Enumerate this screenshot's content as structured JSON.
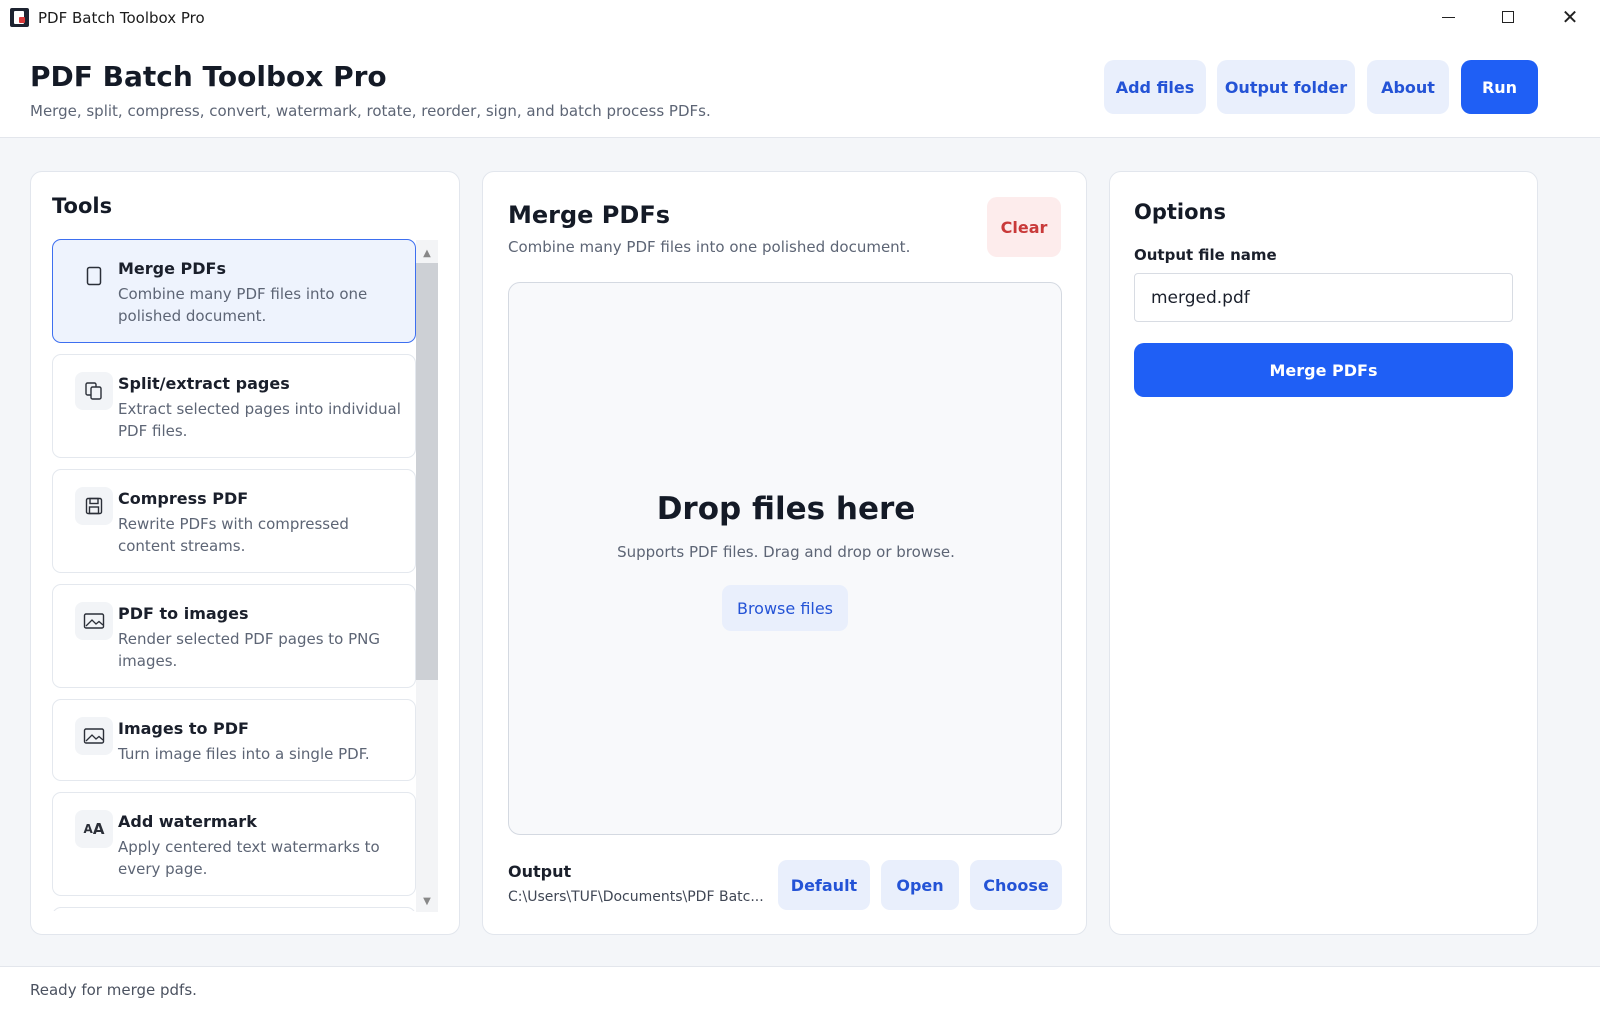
{
  "window": {
    "title": "PDF Batch Toolbox Pro"
  },
  "header": {
    "title": "PDF Batch Toolbox Pro",
    "subtitle": "Merge, split, compress, convert, watermark, rotate, reorder, sign, and batch process PDFs.",
    "buttons": {
      "add_files": "Add files",
      "output_folder": "Output folder",
      "about": "About",
      "run": "Run"
    }
  },
  "tools": {
    "heading": "Tools",
    "items": [
      {
        "title": "Merge PDFs",
        "desc": "Combine many PDF files into one polished document.",
        "icon": "document-icon",
        "active": true
      },
      {
        "title": "Split/extract pages",
        "desc": "Extract selected pages into individual PDF files.",
        "icon": "copy-pages-icon"
      },
      {
        "title": "Compress PDF",
        "desc": "Rewrite PDFs with compressed content streams.",
        "icon": "save-disk-icon"
      },
      {
        "title": "PDF to images",
        "desc": "Render selected PDF pages to PNG images.",
        "icon": "image-icon"
      },
      {
        "title": "Images to PDF",
        "desc": "Turn image files into a single PDF.",
        "icon": "image-icon"
      },
      {
        "title": "Add watermark",
        "desc": "Apply centered text watermarks to every page.",
        "icon": "text-size-icon"
      }
    ]
  },
  "main": {
    "title": "Merge PDFs",
    "subtitle": "Combine many PDF files into one polished document.",
    "clear_label": "Clear",
    "dropzone": {
      "title": "Drop files here",
      "subtitle": "Supports PDF files. Drag and drop or browse.",
      "browse_label": "Browse files"
    },
    "output": {
      "label": "Output",
      "path": "C:\\Users\\TUF\\Documents\\PDF Batc...",
      "default_label": "Default",
      "open_label": "Open",
      "choose_label": "Choose"
    }
  },
  "options": {
    "heading": "Options",
    "filename_label": "Output file name",
    "filename_value": "merged.pdf",
    "action_label": "Merge PDFs"
  },
  "status": {
    "text": "Ready for merge pdfs."
  },
  "colors": {
    "accent": "#1f5ff5",
    "accent_soft": "#e9effc",
    "danger_soft": "#fdecec",
    "danger": "#c93a3a"
  }
}
